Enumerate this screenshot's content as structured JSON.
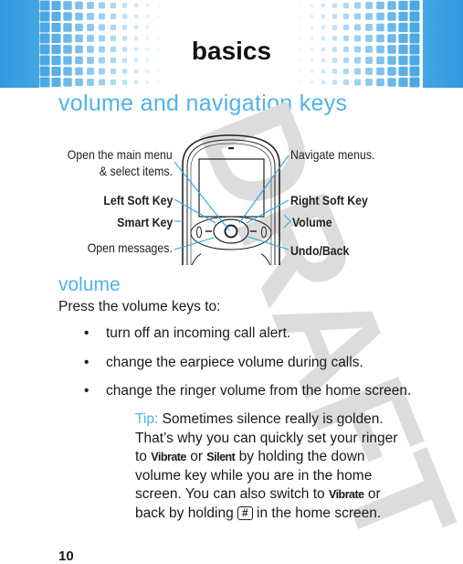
{
  "header": {
    "section_title": "basics",
    "band_color": "#2f9ade"
  },
  "page_heading": "volume and navigation keys",
  "diagram": {
    "labels_left": {
      "main_menu_line1": "Open the main menu",
      "main_menu_line2": "& select items.",
      "left_soft_key": "Left Soft Key",
      "smart_key": "Smart Key",
      "open_messages": "Open messages."
    },
    "labels_right": {
      "navigate": "Navigate menus.",
      "right_soft_key": "Right Soft Key",
      "volume": "Volume",
      "undo_back": "Undo/Back"
    },
    "callout_color": "#29a9e1"
  },
  "section": {
    "heading": "volume",
    "intro": "Press the volume keys to:",
    "bullets": [
      "turn off an incoming call alert.",
      "change the earpiece volume during calls.",
      "change the ringer volume from the home screen."
    ],
    "tip": {
      "label": "Tip:",
      "part1": " Sometimes silence really is golden. That’s why you can quickly set your ringer to ",
      "kw1": "Vibrate",
      "part2": " or ",
      "kw2": "Silent",
      "part3": " by holding the down volume key while you are in the home screen. You can also switch to ",
      "kw3": "Vibrate",
      "part4": " or back by holding ",
      "key": "#",
      "part5": " in the home screen."
    }
  },
  "page_number": "10",
  "watermark": "DRAFT",
  "accent_color": "#4fb3e8"
}
